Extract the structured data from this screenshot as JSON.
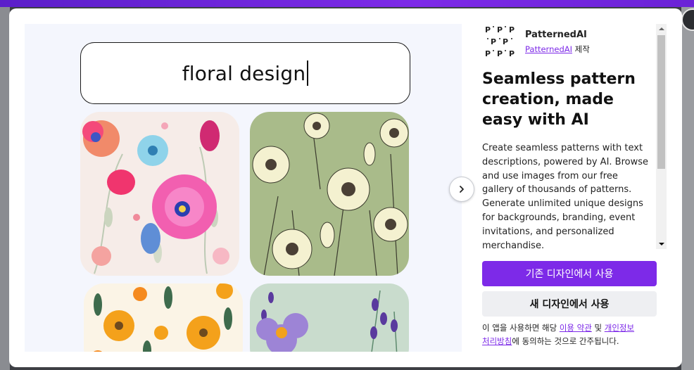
{
  "preview": {
    "prompt_text": "floral design",
    "next_icon": "chevron-right-icon"
  },
  "app": {
    "name": "PatternedAI",
    "maker_link": "PatternedAI",
    "maker_suffix": "제작",
    "logo_letter": "P"
  },
  "headline": "Seamless pattern creation, made easy with AI",
  "description": "Create seamless patterns with text descriptions, powered by AI. Browse and use images from our free gallery of thousands of patterns. Generate unlimited unique designs for backgrounds, branding, event invitations, and personalized merchandise.",
  "buttons": {
    "use_existing": "기존 디자인에서 사용",
    "use_new": "새 디자인에서 사용"
  },
  "legal": {
    "prefix": "이 앱을 사용하면 해당",
    "terms_link": "이용 약관",
    "and": "및",
    "privacy_link_1": "개인정보",
    "privacy_link_2": "처리방침",
    "suffix": "에 동의하는 것으로 간주됩니다."
  },
  "colors": {
    "accent": "#7d2ae8",
    "preview_bg": "#f4f6fd",
    "secondary_button": "#eeeff2"
  }
}
